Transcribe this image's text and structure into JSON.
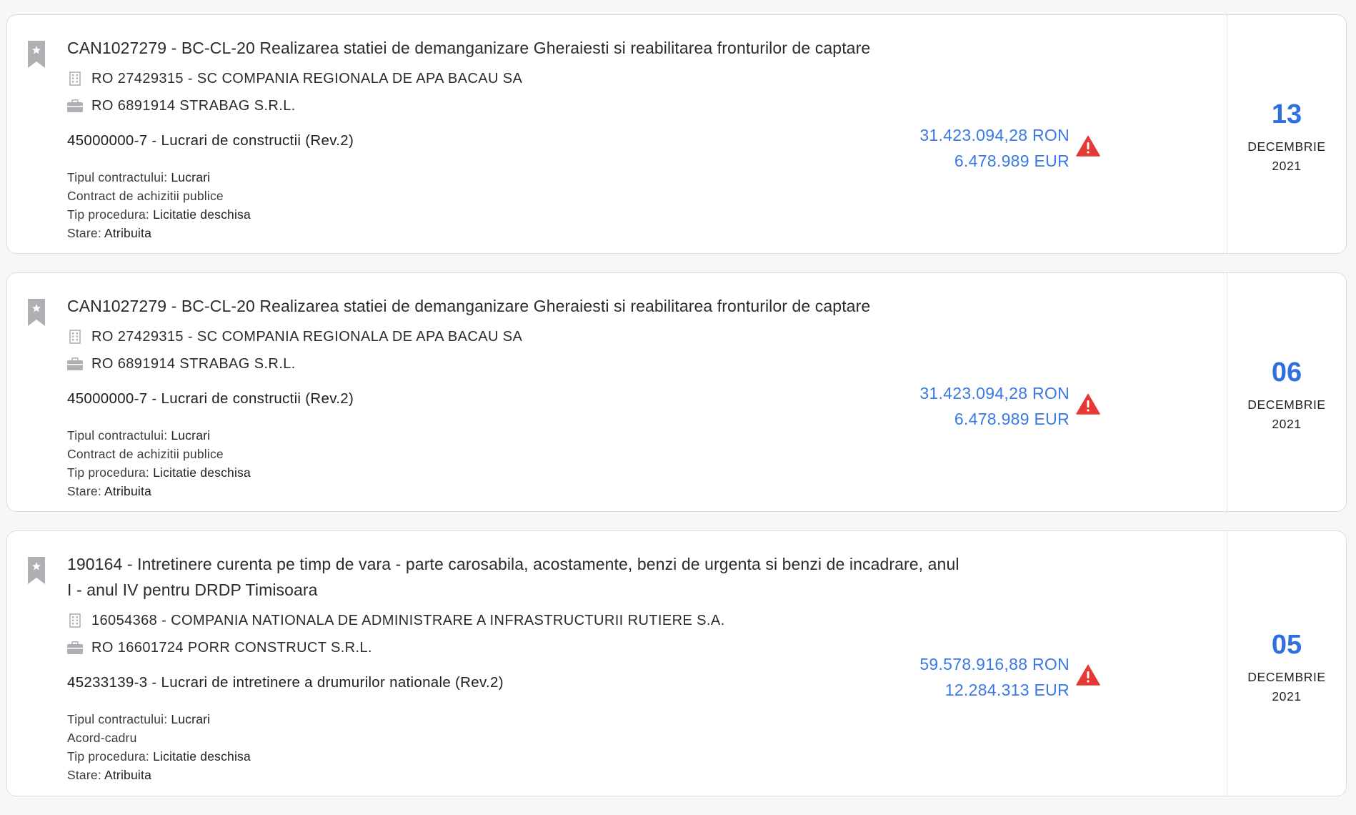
{
  "colors": {
    "accent": "#2f6fe0",
    "value_text": "#3a78e6",
    "warning": "#e53935",
    "icon_gray": "#b0b0b4"
  },
  "items": [
    {
      "title": "CAN1027279 - BC-CL-20 Realizarea statiei de demanganizare Gheraiesti si reabilitarea fronturilor de captare",
      "authority": "RO 27429315 - SC COMPANIA REGIONALA DE APA BACAU SA",
      "supplier": "RO 6891914 STRABAG S.R.L.",
      "cpv": "45000000-7 - Lucrari de constructii (Rev.2)",
      "contract_type_label": "Tipul contractului:",
      "contract_type": "Lucrari",
      "contract_kind": "Contract de achizitii publice",
      "procedure_label": "Tip procedura:",
      "procedure": "Licitatie deschisa",
      "status_label": "Stare:",
      "status": "Atribuita",
      "value_ron": "31.423.094,28 RON",
      "value_eur": "6.478.989 EUR",
      "warning_icon": "warning-triangle-icon",
      "day": "13",
      "month": "DECEMBRIE",
      "year": "2021"
    },
    {
      "title": "CAN1027279 - BC-CL-20 Realizarea statiei de demanganizare Gheraiesti si reabilitarea fronturilor de captare",
      "authority": "RO 27429315 - SC COMPANIA REGIONALA DE APA BACAU SA",
      "supplier": "RO 6891914 STRABAG S.R.L.",
      "cpv": "45000000-7 - Lucrari de constructii (Rev.2)",
      "contract_type_label": "Tipul contractului:",
      "contract_type": "Lucrari",
      "contract_kind": "Contract de achizitii publice",
      "procedure_label": "Tip procedura:",
      "procedure": "Licitatie deschisa",
      "status_label": "Stare:",
      "status": "Atribuita",
      "value_ron": "31.423.094,28 RON",
      "value_eur": "6.478.989 EUR",
      "warning_icon": "warning-triangle-icon",
      "day": "06",
      "month": "DECEMBRIE",
      "year": "2021"
    },
    {
      "title": "190164 - Intretinere curenta pe timp de vara - parte carosabila, acostamente, benzi de urgenta si benzi de incadrare, anul I - anul IV pentru DRDP Timisoara",
      "authority": "16054368 - COMPANIA NATIONALA DE ADMINISTRARE A INFRASTRUCTURII RUTIERE S.A.",
      "supplier": "RO 16601724 PORR CONSTRUCT S.R.L.",
      "cpv": "45233139-3 - Lucrari de intretinere a drumurilor nationale (Rev.2)",
      "contract_type_label": "Tipul contractului:",
      "contract_type": "Lucrari",
      "contract_kind": "Acord-cadru",
      "procedure_label": "Tip procedura:",
      "procedure": "Licitatie deschisa",
      "status_label": "Stare:",
      "status": "Atribuita",
      "value_ron": "59.578.916,88 RON",
      "value_eur": "12.284.313 EUR",
      "warning_icon": "warning-triangle-icon",
      "day": "05",
      "month": "DECEMBRIE",
      "year": "2021"
    }
  ]
}
